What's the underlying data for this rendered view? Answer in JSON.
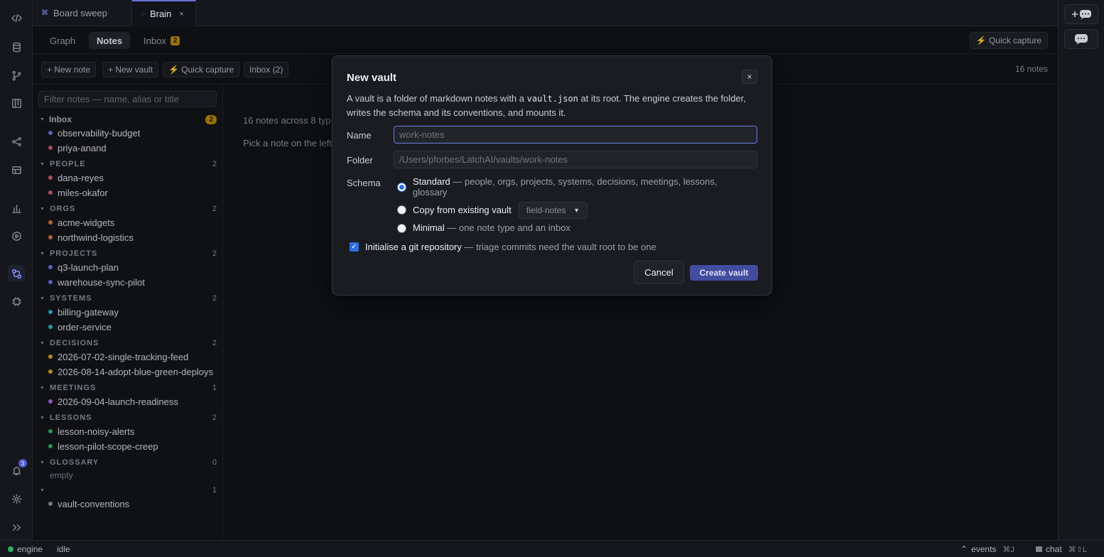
{
  "tabs": [
    {
      "icon": "⌘",
      "label": "Board sweep"
    },
    {
      "icon": "◌",
      "label": "Brain",
      "close": "×"
    }
  ],
  "subtabs": {
    "graph": "Graph",
    "notes": "Notes",
    "inbox": "Inbox",
    "inbox_count": "2",
    "quick_capture": "⚡ Quick capture"
  },
  "toolbar": {
    "new_note": "+ New note",
    "new_vault": "+ New vault",
    "quick_capture": "⚡ Quick capture",
    "inbox": "Inbox (2)",
    "notes_count": "16 notes"
  },
  "sidebar": {
    "filter_placeholder": "Filter notes — name, alias or title",
    "groups": [
      {
        "name": "Inbox",
        "count": "2",
        "notes": [
          "observability-budget",
          "priya-anand"
        ]
      },
      {
        "name": "PEOPLE",
        "count": "2",
        "notes": [
          "dana-reyes",
          "miles-okafor"
        ]
      },
      {
        "name": "ORGS",
        "count": "2",
        "notes": [
          "acme-widgets",
          "northwind-logistics"
        ]
      },
      {
        "name": "PROJECTS",
        "count": "2",
        "notes": [
          "q3-launch-plan",
          "warehouse-sync-pilot"
        ]
      },
      {
        "name": "SYSTEMS",
        "count": "2",
        "notes": [
          "billing-gateway",
          "order-service"
        ]
      },
      {
        "name": "DECISIONS",
        "count": "2",
        "notes": [
          "2026-07-02-single-tracking-feed",
          "2026-08-14-adopt-blue-green-deploys"
        ]
      },
      {
        "name": "MEETINGS",
        "count": "1",
        "notes": [
          "2026-09-04-launch-readiness"
        ]
      },
      {
        "name": "LESSONS",
        "count": "2",
        "notes": [
          "lesson-noisy-alerts",
          "lesson-pilot-scope-creep"
        ]
      },
      {
        "name": "GLOSSARY",
        "count": "0",
        "empty": "empty"
      },
      {
        "name": "",
        "count": "1",
        "notes": [
          "vault-conventions"
        ]
      }
    ]
  },
  "main": {
    "summary": "16 notes across 8 typ",
    "hint": "Pick a note on the left"
  },
  "modal": {
    "title": "New vault",
    "close": "×",
    "desc_1": "A vault is a folder of markdown notes with a ",
    "desc_code": "vault.json",
    "desc_2": " at its root. The engine creates the folder, writes the schema and its conventions, and mounts it.",
    "name_label": "Name",
    "name_placeholder": "work-notes",
    "folder_label": "Folder",
    "folder_placeholder": "/Users/pforbes/LatchAI/vaults/work-notes",
    "schema_label": "Schema",
    "schema_options": [
      {
        "name": "Standard",
        "desc": " — people, orgs, projects, systems, decisions, meetings, lessons, glossary"
      },
      {
        "name": "Copy from existing vault",
        "desc": ""
      },
      {
        "name": "Minimal",
        "desc": " — one note type and an inbox"
      }
    ],
    "copy_select": "field-notes",
    "git_label": "Initialise a git repository",
    "git_desc": " — triage commits need the vault root to be one",
    "cancel": "Cancel",
    "create": "Create vault"
  },
  "rail": {
    "notif_count": "3"
  },
  "status": {
    "engine": "engine",
    "state": "idle",
    "events": "events",
    "events_kbd": "⌘J",
    "chat": "chat",
    "chat_kbd": "⌘⇧L"
  },
  "dot_colors": {
    "inbox": "#6b72e0",
    "people": "#d0566e",
    "orgs": "#d9743a",
    "projects": "#6b72e0",
    "systems": "#2fb3c4",
    "decisions": "#d4a11e",
    "meetings": "#b06ad9",
    "lessons": "#2fae63",
    "other": "#8b909b"
  }
}
